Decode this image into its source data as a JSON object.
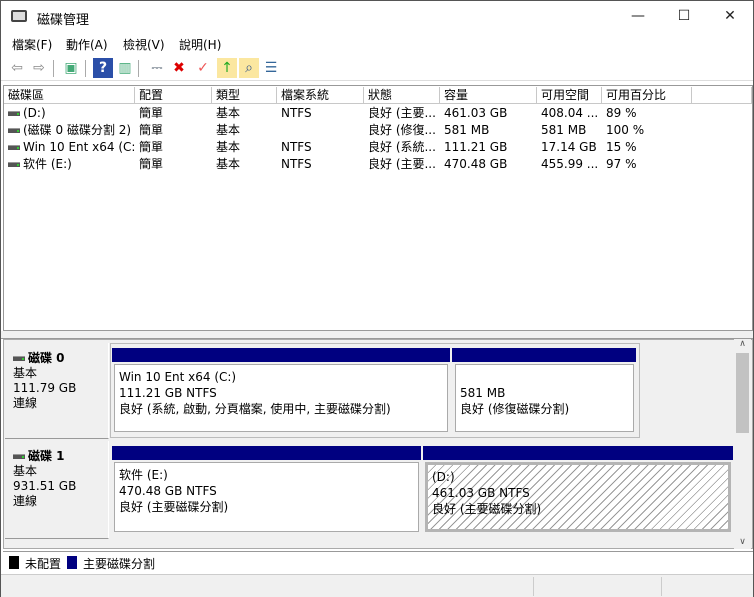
{
  "window": {
    "title": "磁碟管理",
    "minimize": "—",
    "maximize": "☐",
    "close": "✕"
  },
  "menu": [
    "檔案(F)",
    "動作(A)",
    "檢視(V)",
    "說明(H)"
  ],
  "toolbar": [
    {
      "name": "back-icon",
      "glyph": "⇦",
      "color": "#888"
    },
    {
      "name": "forward-icon",
      "glyph": "⇨",
      "color": "#888"
    },
    {
      "name": "console-tree-icon",
      "glyph": "▣",
      "color": "#4a7"
    },
    {
      "name": "help-icon",
      "glyph": "?",
      "color": "#fff"
    },
    {
      "name": "action-pane-icon",
      "glyph": "▥",
      "color": "#4a7"
    },
    {
      "name": "connect-disk-icon",
      "glyph": "⎓",
      "color": "#456"
    },
    {
      "name": "delete-icon",
      "glyph": "✖",
      "color": "#d00"
    },
    {
      "name": "properties-icon",
      "glyph": "✓",
      "color": "#e55"
    },
    {
      "name": "open-icon",
      "glyph": "↑",
      "color": "#2a2"
    },
    {
      "name": "explore-icon",
      "glyph": "⌕",
      "color": "#358"
    },
    {
      "name": "list-view-icon",
      "glyph": "☰",
      "color": "#369"
    }
  ],
  "columns": [
    "磁碟區",
    "配置",
    "類型",
    "檔案系統",
    "狀態",
    "容量",
    "可用空間",
    "可用百分比"
  ],
  "volumes": [
    [
      "(D:)",
      "簡單",
      "基本",
      "NTFS",
      "良好 (主要...",
      "461.03 GB",
      "408.04 ...",
      "89 %"
    ],
    [
      "(磁碟 0 磁碟分割 2)",
      "簡單",
      "基本",
      "",
      "良好 (修復...",
      "581 MB",
      "581 MB",
      "100 %"
    ],
    [
      "Win 10 Ent x64 (C:)",
      "簡單",
      "基本",
      "NTFS",
      "良好 (系統...",
      "111.21 GB",
      "17.14 GB",
      "15 %"
    ],
    [
      "软件 (E:)",
      "簡單",
      "基本",
      "NTFS",
      "良好 (主要...",
      "470.48 GB",
      "455.99 ...",
      "97 %"
    ]
  ],
  "disks": [
    {
      "name": "磁碟 0",
      "type": "基本",
      "size": "111.79 GB",
      "state": "連線",
      "partitions": [
        {
          "title": "Win 10 Ent x64  (C:)",
          "size": "111.21 GB NTFS",
          "status": "良好 (系統, 啟動, 分頁檔案, 使用中, 主要磁碟分割)"
        },
        {
          "title": "",
          "size": "581 MB",
          "status": "良好 (修復磁碟分割)"
        }
      ]
    },
    {
      "name": "磁碟 1",
      "type": "基本",
      "size": "931.51 GB",
      "state": "連線",
      "partitions": [
        {
          "title": "软件  (E:)",
          "size": "470.48 GB NTFS",
          "status": "良好 (主要磁碟分割)"
        },
        {
          "title": " (D:)",
          "size": "461.03 GB NTFS",
          "status": "良好 (主要磁碟分割)"
        }
      ]
    }
  ],
  "legend": [
    {
      "label": "未配置",
      "color": "#000000"
    },
    {
      "label": "主要磁碟分割",
      "color": "#000080"
    }
  ],
  "colors": {
    "primary_partition": "#000080",
    "unallocated": "#000000"
  }
}
